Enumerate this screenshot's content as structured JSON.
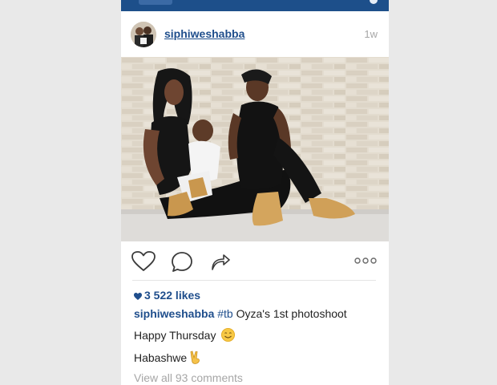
{
  "post": {
    "username": "siphiweshabba",
    "time_ago": "1w",
    "likes": "3 522 likes",
    "caption_user": "siphiweshabba",
    "caption_tag": "#tb",
    "caption_text": " Oyza's 1st photoshoot",
    "line2": "Happy Thursday",
    "line3": "Habashwe",
    "view_all": "View all 93 comments"
  },
  "icons": {
    "like": "heart-outline-icon",
    "comment": "comment-bubble-icon",
    "share": "share-arrow-icon",
    "more": "more-dots-icon",
    "likes_heart": "heart-filled-icon",
    "smile": "smile-emoji",
    "victory": "victory-hand-emoji"
  },
  "colors": {
    "link_blue": "#1f4e8c",
    "top_bar": "#1d4f8a",
    "muted": "#a6a6a6"
  }
}
